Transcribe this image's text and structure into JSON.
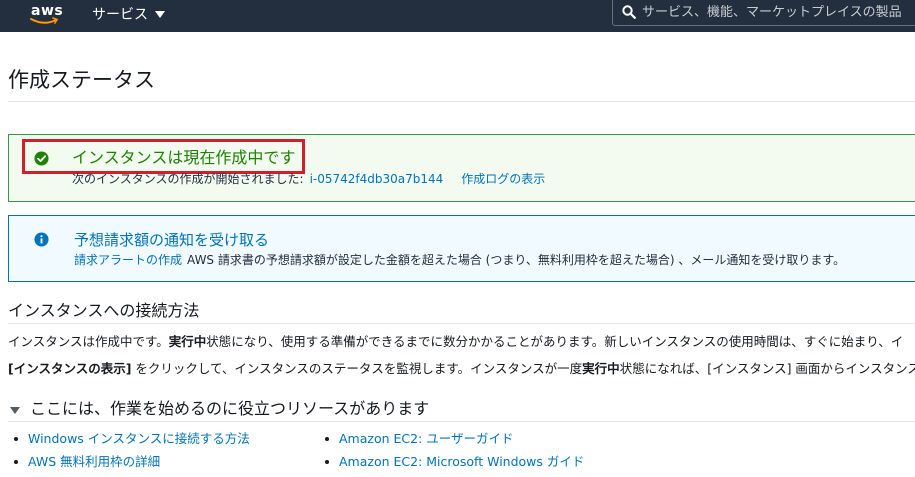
{
  "nav": {
    "logo_text": "aws",
    "services_label": "サービス",
    "search_placeholder": "サービス、機能、マーケットプレイスの製品、ドキュ"
  },
  "page": {
    "title": "作成ステータス"
  },
  "success_alert": {
    "heading": "インスタンスは現在作成中です",
    "body_prefix": "次のインスタンスの作成が開始されました:",
    "instance_id": "i-05742f4db30a7b144",
    "log_link": "作成ログの表示",
    "color": "#1d8102"
  },
  "info_alert": {
    "heading": "予想請求額の通知を受け取る",
    "link": "請求アラートの作成",
    "body": "AWS 請求書の予想請求額が設定した金額を超えた場合 (つまり、無料利用枠を超えた場合) 、メール通知を受け取ります。",
    "color": "#0073bb"
  },
  "connect_section": {
    "title": "インスタンスへの接続方法",
    "para1_a": "インスタンスは作成中です。",
    "para1_bold": "実行中",
    "para1_b": "状態になり、使用する準備ができるまでに数分かかることがあります。新しいインスタンスの使用時間は、すぐに始まり、イ",
    "para2_bold1": "[インスタンスの表示]",
    "para2_a": " をクリックして、インスタンスのステータスを監視します。インスタンスが一度",
    "para2_bold2": "実行中",
    "para2_b": "状態になれば、[インスタンス] 画面からインスタンス"
  },
  "resources": {
    "toggle_label": "ここには、作業を始めるのに役立つリソースがあります",
    "left_links": [
      "Windows インスタンスに接続する方法",
      "AWS 無料利用枠の詳細"
    ],
    "right_links": [
      "Amazon EC2: ユーザーガイド",
      "Amazon EC2: Microsoft Windows ガイド"
    ]
  },
  "icons": {
    "success": "check-circle-icon",
    "info": "info-circle-icon",
    "search": "search-icon",
    "caret": "caret-down-icon"
  }
}
